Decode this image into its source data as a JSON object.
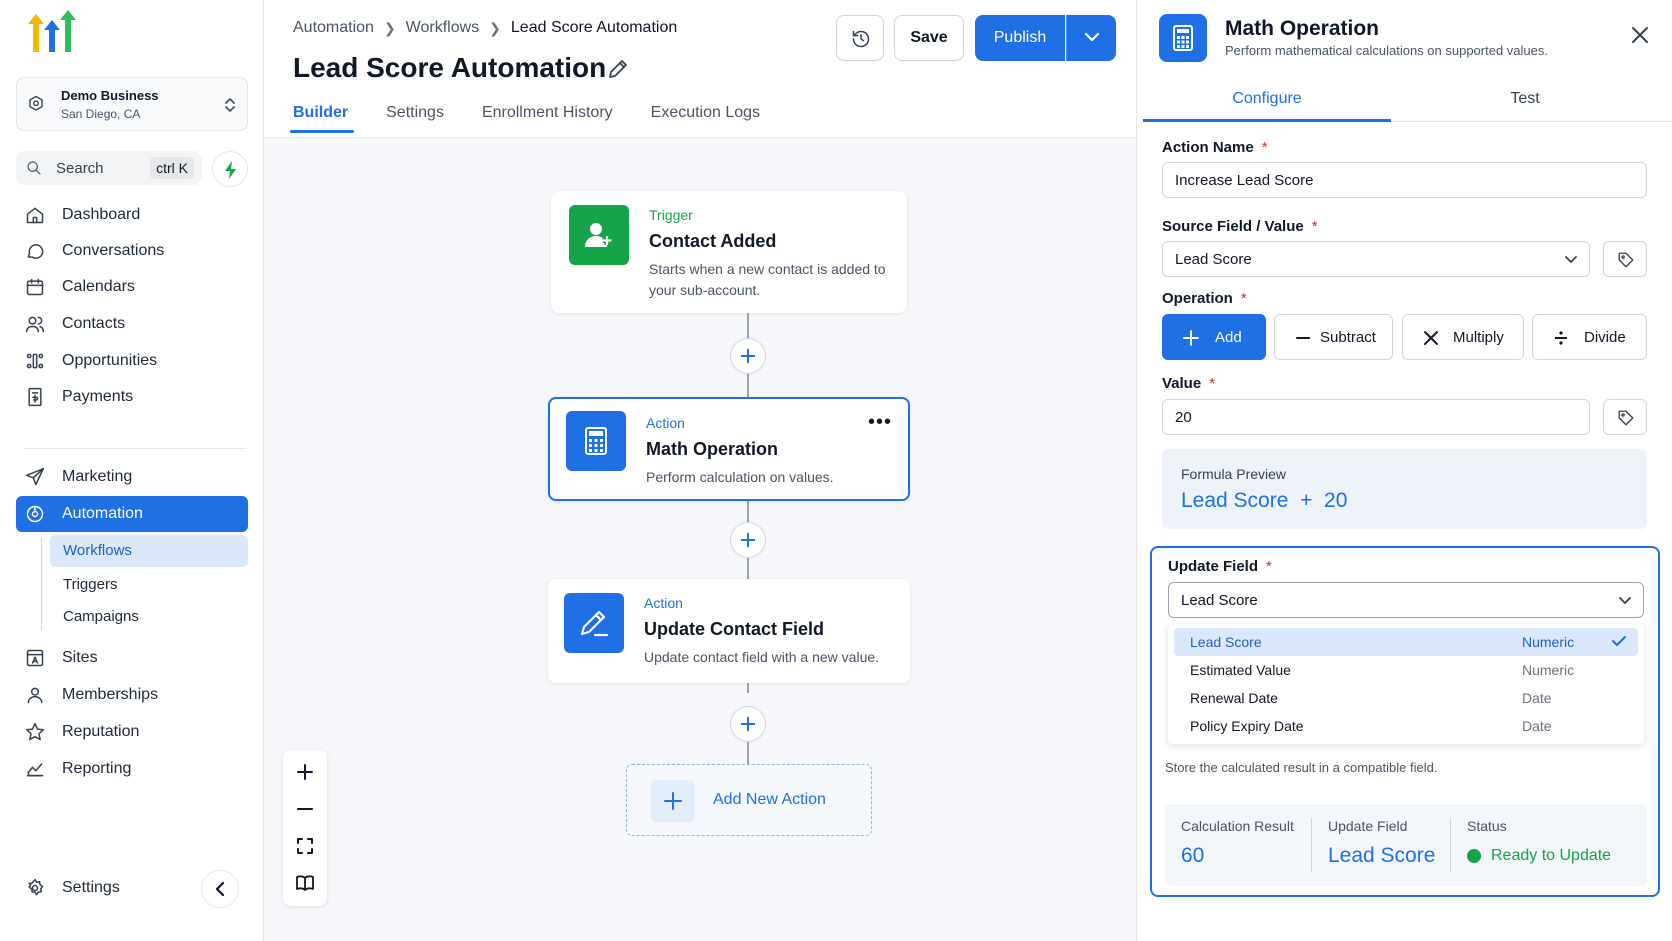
{
  "colors": {
    "primary": "#1f6fe5",
    "success": "#16a34a",
    "required": "#dc2626"
  },
  "sidebar": {
    "business": {
      "name": "Demo Business",
      "location": "San Diego, CA"
    },
    "search": {
      "label": "Search",
      "shortcut": "ctrl K"
    },
    "items": [
      {
        "label": "Dashboard",
        "icon": "home-icon"
      },
      {
        "label": "Conversations",
        "icon": "chat-icon"
      },
      {
        "label": "Calendars",
        "icon": "calendar-icon"
      },
      {
        "label": "Contacts",
        "icon": "contacts-icon"
      },
      {
        "label": "Opportunities",
        "icon": "opportunities-icon"
      },
      {
        "label": "Payments",
        "icon": "payments-icon"
      },
      {
        "label": "Marketing",
        "icon": "send-icon"
      },
      {
        "label": "Automation",
        "icon": "automation-icon"
      },
      {
        "label": "Sites",
        "icon": "sites-icon"
      },
      {
        "label": "Memberships",
        "icon": "user-icon"
      },
      {
        "label": "Reputation",
        "icon": "star-icon"
      },
      {
        "label": "Reporting",
        "icon": "chart-icon"
      }
    ],
    "automation_sub": [
      "Workflows",
      "Triggers",
      "Campaigns"
    ],
    "settings_label": "Settings"
  },
  "header": {
    "breadcrumb": [
      "Automation",
      "Workflows",
      "Lead Score Automation"
    ],
    "title": "Lead Score Automation",
    "tabs": [
      "Builder",
      "Settings",
      "Enrollment History",
      "Execution Logs"
    ],
    "save_label": "Save",
    "publish_label": "Publish"
  },
  "canvas": {
    "nodes": [
      {
        "kind": "Trigger",
        "title": "Contact Added",
        "desc": "Starts when a new contact is added to your sub-account."
      },
      {
        "kind": "Action",
        "title": "Math Operation",
        "desc": "Perform calculation on values."
      },
      {
        "kind": "Action",
        "title": "Update Contact Field",
        "desc": "Update contact field with a new value."
      }
    ],
    "add_action_label": "Add New Action"
  },
  "panel": {
    "title": "Math Operation",
    "subtitle": "Perform mathematical calculations on supported values.",
    "tabs": [
      "Configure",
      "Test"
    ],
    "action_name_label": "Action Name",
    "action_name_value": "Increase Lead Score",
    "source_label": "Source Field / Value",
    "source_value": "Lead Score",
    "operation_label": "Operation",
    "operations": [
      "Add",
      "Subtract",
      "Multiply",
      "Divide"
    ],
    "value_label": "Value",
    "value_value": "20",
    "formula_label": "Formula Preview",
    "formula": "Lead Score  +  20",
    "update_field_label": "Update Field",
    "update_field_value": "Lead Score",
    "field_options": [
      {
        "name": "Lead Score",
        "type": "Numeric"
      },
      {
        "name": "Estimated Value",
        "type": "Numeric"
      },
      {
        "name": "Renewal Date",
        "type": "Date"
      },
      {
        "name": "Policy Expiry Date",
        "type": "Date"
      }
    ],
    "update_help": "Store the calculated result in a compatible field.",
    "result_label": "Calculation Result",
    "result_value": "60",
    "result_field_label": "Update Field",
    "result_field_value": "Lead Score",
    "status_label": "Status",
    "status_value": "Ready to Update"
  }
}
